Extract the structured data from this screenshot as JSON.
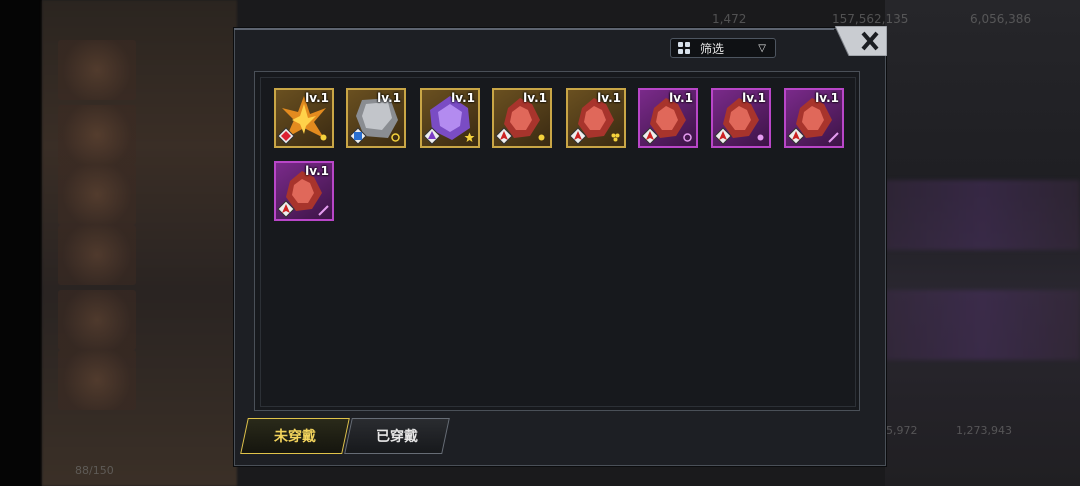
{
  "background": {
    "top_numbers": [
      "1,472",
      "157,562,135",
      "6,056,386"
    ],
    "bottom_left_count": "88/150",
    "bottom_numbers": [
      "5,972",
      "1,273,943"
    ]
  },
  "panel": {
    "filter_label": "筛选",
    "close_icon": "close-x-icon",
    "items": [
      {
        "level": "lv.1",
        "rarity": "gold",
        "gem": "flame-shard-icon",
        "right_badge": "burst-icon"
      },
      {
        "level": "lv.1",
        "rarity": "gold",
        "gem": "stone-block-icon",
        "right_badge": "target-icon"
      },
      {
        "level": "lv.1",
        "rarity": "gold",
        "gem": "violet-crystal-icon",
        "right_badge": "star-icon"
      },
      {
        "level": "lv.1",
        "rarity": "gold",
        "gem": "red-crystal-icon",
        "right_badge": "runner-icon"
      },
      {
        "level": "lv.1",
        "rarity": "gold",
        "gem": "red-crystal-icon",
        "right_badge": "cluster-icon"
      },
      {
        "level": "lv.1",
        "rarity": "purple",
        "gem": "red-crystal-icon",
        "right_badge": "crosshair-icon"
      },
      {
        "level": "lv.1",
        "rarity": "purple",
        "gem": "red-crystal-icon",
        "right_badge": "flower-icon"
      },
      {
        "level": "lv.1",
        "rarity": "purple",
        "gem": "red-crystal-icon",
        "right_badge": "sword-icon"
      },
      {
        "level": "lv.1",
        "rarity": "purple",
        "gem": "red-crystal-icon",
        "right_badge": "sword-icon"
      }
    ],
    "tabs": [
      {
        "label": "未穿戴",
        "active": true
      },
      {
        "label": "已穿戴",
        "active": false
      }
    ]
  },
  "colors": {
    "gold_frame": "#c9a646",
    "purple_frame": "#b946c8",
    "active_tab": "#f2d35c"
  }
}
